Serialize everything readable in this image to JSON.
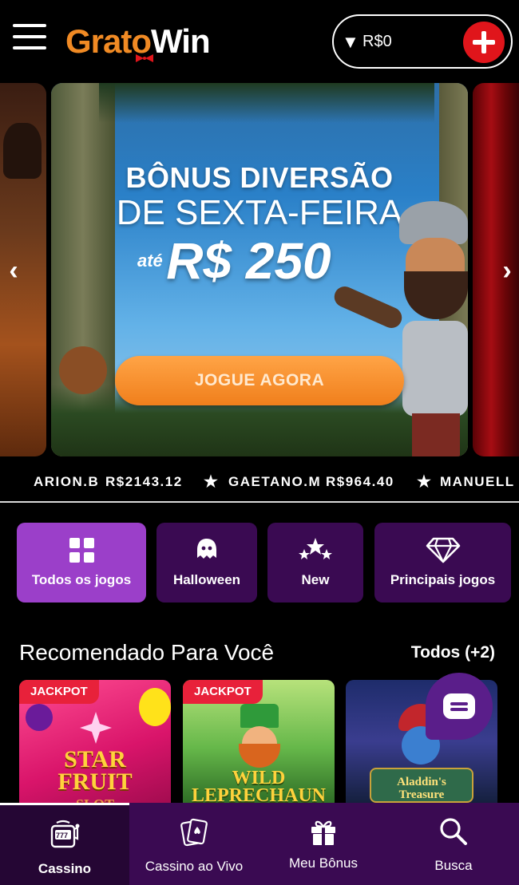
{
  "header": {
    "logo_part1": "Grato",
    "logo_part2": "Win",
    "balance": "R$0",
    "balance_caret": "▼"
  },
  "banner": {
    "line1": "BÔNUS DIVERSÃO",
    "line2": "DE SEXTA-FEIRA",
    "prefix": "até",
    "amount": "R$ 250",
    "cta": "JOGUE AGORA"
  },
  "ticker": {
    "items": [
      {
        "name": "ARION.B",
        "amount": "R$2143.12"
      },
      {
        "name": "GAETANO.M",
        "amount": "R$964.40"
      },
      {
        "name": "MANUELL",
        "amount": ""
      }
    ]
  },
  "categories": [
    {
      "label": "Todos os jogos",
      "icon": "grid-icon",
      "active": true
    },
    {
      "label": "Halloween",
      "icon": "ghost-icon",
      "active": false
    },
    {
      "label": "New",
      "icon": "stars-icon",
      "active": false
    },
    {
      "label": "Principais jogos",
      "icon": "diamond-icon",
      "active": false
    }
  ],
  "recommended": {
    "title": "Recomendado Para Você",
    "all_link": "Todos (+2)",
    "games": [
      {
        "badge": "JACKPOT",
        "title_line1": "STAR",
        "title_line2": "FRUIT",
        "title_line3": "SLOT"
      },
      {
        "badge": "JACKPOT",
        "title_line1": "WILD",
        "title_line2": "LEPRECHAUN"
      },
      {
        "title_line1": "Aladdin's",
        "title_line2": "Treasure"
      }
    ]
  },
  "bottom_nav": [
    {
      "label": "Cassino",
      "icon": "slot-machine-icon",
      "active": true
    },
    {
      "label": "Cassino ao Vivo",
      "icon": "cards-icon",
      "active": false
    },
    {
      "label": "Meu Bônus",
      "icon": "gift-icon",
      "active": false
    },
    {
      "label": "Busca",
      "icon": "search-icon",
      "active": false
    }
  ],
  "colors": {
    "brand_orange": "#f08a24",
    "active_purple": "#9b3fc9",
    "tab_purple": "#3a0a52",
    "jackpot_red": "#e8213a",
    "add_funds_red": "#e0151b"
  }
}
